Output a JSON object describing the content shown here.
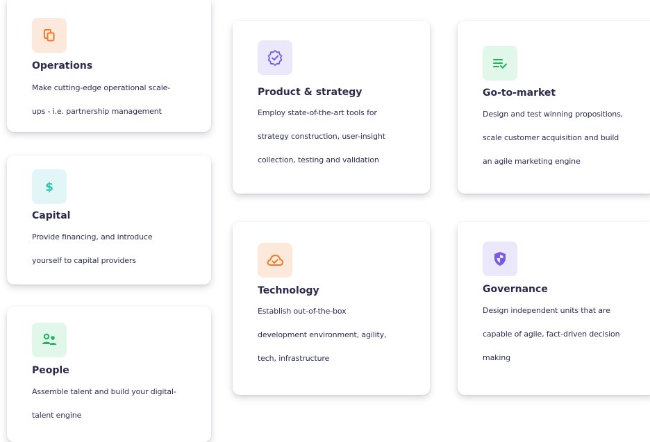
{
  "colors": {
    "orange": "#f07b2c",
    "purple": "#7b5ce0",
    "green": "#1fb35b",
    "teal": "#2fc1b1",
    "text": "#2b2a4c"
  },
  "cards": {
    "operations": {
      "icon": "copy-icon",
      "title": "Operations",
      "lines": [
        "Make cutting-edge operational scale-",
        "ups - i.e. partnership management"
      ]
    },
    "capital": {
      "icon": "dollar-icon",
      "title": "Capital",
      "lines": [
        "Provide financing, and introduce",
        "yourself to capital providers"
      ]
    },
    "people": {
      "icon": "people-icon",
      "title": "People",
      "lines": [
        "Assemble talent and build your digital-",
        "talent engine"
      ]
    },
    "product": {
      "icon": "verified-badge-icon",
      "title": "Product & strategy",
      "lines": [
        "Employ state-of-the-art tools for",
        "strategy construction, user-insight",
        "collection, testing and validation"
      ]
    },
    "technology": {
      "icon": "cloud-check-icon",
      "title": "Technology",
      "lines": [
        "Establish out-of-the-box",
        "development environment, agility,",
        "tech, infrastructure"
      ]
    },
    "gtm": {
      "icon": "list-check-icon",
      "title": "Go-to-market",
      "lines": [
        "Design and test winning propositions,",
        "scale customer acquisition and build",
        "an agile marketing engine"
      ]
    },
    "governance": {
      "icon": "shield-icon",
      "title": "Governance",
      "lines": [
        "Design independent units that are",
        "capable of agile, fact-driven decision",
        "making"
      ]
    }
  }
}
